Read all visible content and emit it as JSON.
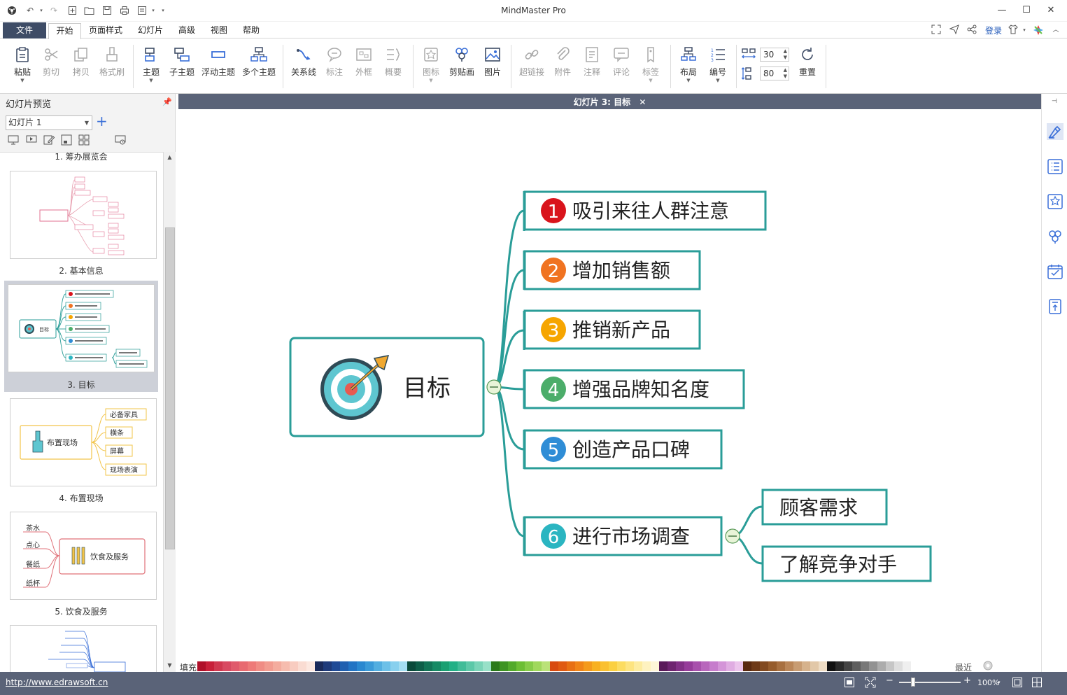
{
  "window": {
    "title": "MindMaster Pro",
    "minimize": "—",
    "maximize": "☐",
    "close": "✕"
  },
  "menu": {
    "tabs": [
      "文件",
      "开始",
      "页面样式",
      "幻灯片",
      "高级",
      "视图",
      "帮助"
    ],
    "login": "登录"
  },
  "ribbon": {
    "buttons": [
      {
        "label": "粘贴",
        "enabled": true,
        "dropdown": true
      },
      {
        "label": "剪切",
        "enabled": false
      },
      {
        "label": "拷贝",
        "enabled": false
      },
      {
        "label": "格式刷",
        "enabled": false
      },
      {
        "label": "主题",
        "enabled": true,
        "dropdown": true
      },
      {
        "label": "子主题",
        "enabled": true
      },
      {
        "label": "浮动主题",
        "enabled": true
      },
      {
        "label": "多个主题",
        "enabled": true
      },
      {
        "label": "关系线",
        "enabled": true
      },
      {
        "label": "标注",
        "enabled": false
      },
      {
        "label": "外框",
        "enabled": false
      },
      {
        "label": "概要",
        "enabled": false
      },
      {
        "label": "图标",
        "enabled": false,
        "dropdown": true
      },
      {
        "label": "剪贴画",
        "enabled": true
      },
      {
        "label": "图片",
        "enabled": true
      },
      {
        "label": "超链接",
        "enabled": false
      },
      {
        "label": "附件",
        "enabled": false
      },
      {
        "label": "注释",
        "enabled": false
      },
      {
        "label": "评论",
        "enabled": false
      },
      {
        "label": "标签",
        "enabled": false,
        "dropdown": true
      },
      {
        "label": "布局",
        "enabled": true,
        "dropdown": true
      },
      {
        "label": "编号",
        "enabled": true,
        "dropdown": true
      },
      {
        "label": "重置",
        "enabled": true
      }
    ],
    "spacing_h": "30",
    "spacing_v": "80"
  },
  "left_panel": {
    "title": "幻灯片预览",
    "selected_slide": "幻灯片 1",
    "slides": [
      {
        "caption": "1. 筹办展览会"
      },
      {
        "caption": "2. 基本信息"
      },
      {
        "caption": "3. 目标",
        "active": true
      },
      {
        "caption": "4. 布置现场",
        "thumb_root": "布置现场",
        "thumb_children": [
          "必备家具",
          "横条",
          "屏幕",
          "现场表演"
        ]
      },
      {
        "caption": "5. 饮食及服务",
        "thumb_root": "饮食及服务",
        "thumb_children": [
          "茶水",
          "点心",
          "餐纸",
          "纸杯"
        ]
      }
    ]
  },
  "document_tab": {
    "label": "幻灯片 3: 目标",
    "close": "✕"
  },
  "mindmap": {
    "root": "目标",
    "branches": [
      {
        "num": "1",
        "text": "吸引来往人群注意",
        "color": "#d9141c"
      },
      {
        "num": "2",
        "text": "增加销售额",
        "color": "#f07321"
      },
      {
        "num": "3",
        "text": "推销新产品",
        "color": "#f6a500"
      },
      {
        "num": "4",
        "text": "增强品牌知名度",
        "color": "#4cad6a"
      },
      {
        "num": "5",
        "text": "创造产品口碑",
        "color": "#2f8dd6"
      },
      {
        "num": "6",
        "text": "进行市场调查",
        "color": "#2bb5c1"
      }
    ],
    "sub_branches": [
      "顾客需求",
      "了解竞争对手"
    ],
    "line_color": "#2a9d98",
    "border_color": "#2a9d98"
  },
  "palette": {
    "label": "填充",
    "recent": "最近"
  },
  "status": {
    "url": "http://www.edrawsoft.cn",
    "zoom": "100%"
  }
}
